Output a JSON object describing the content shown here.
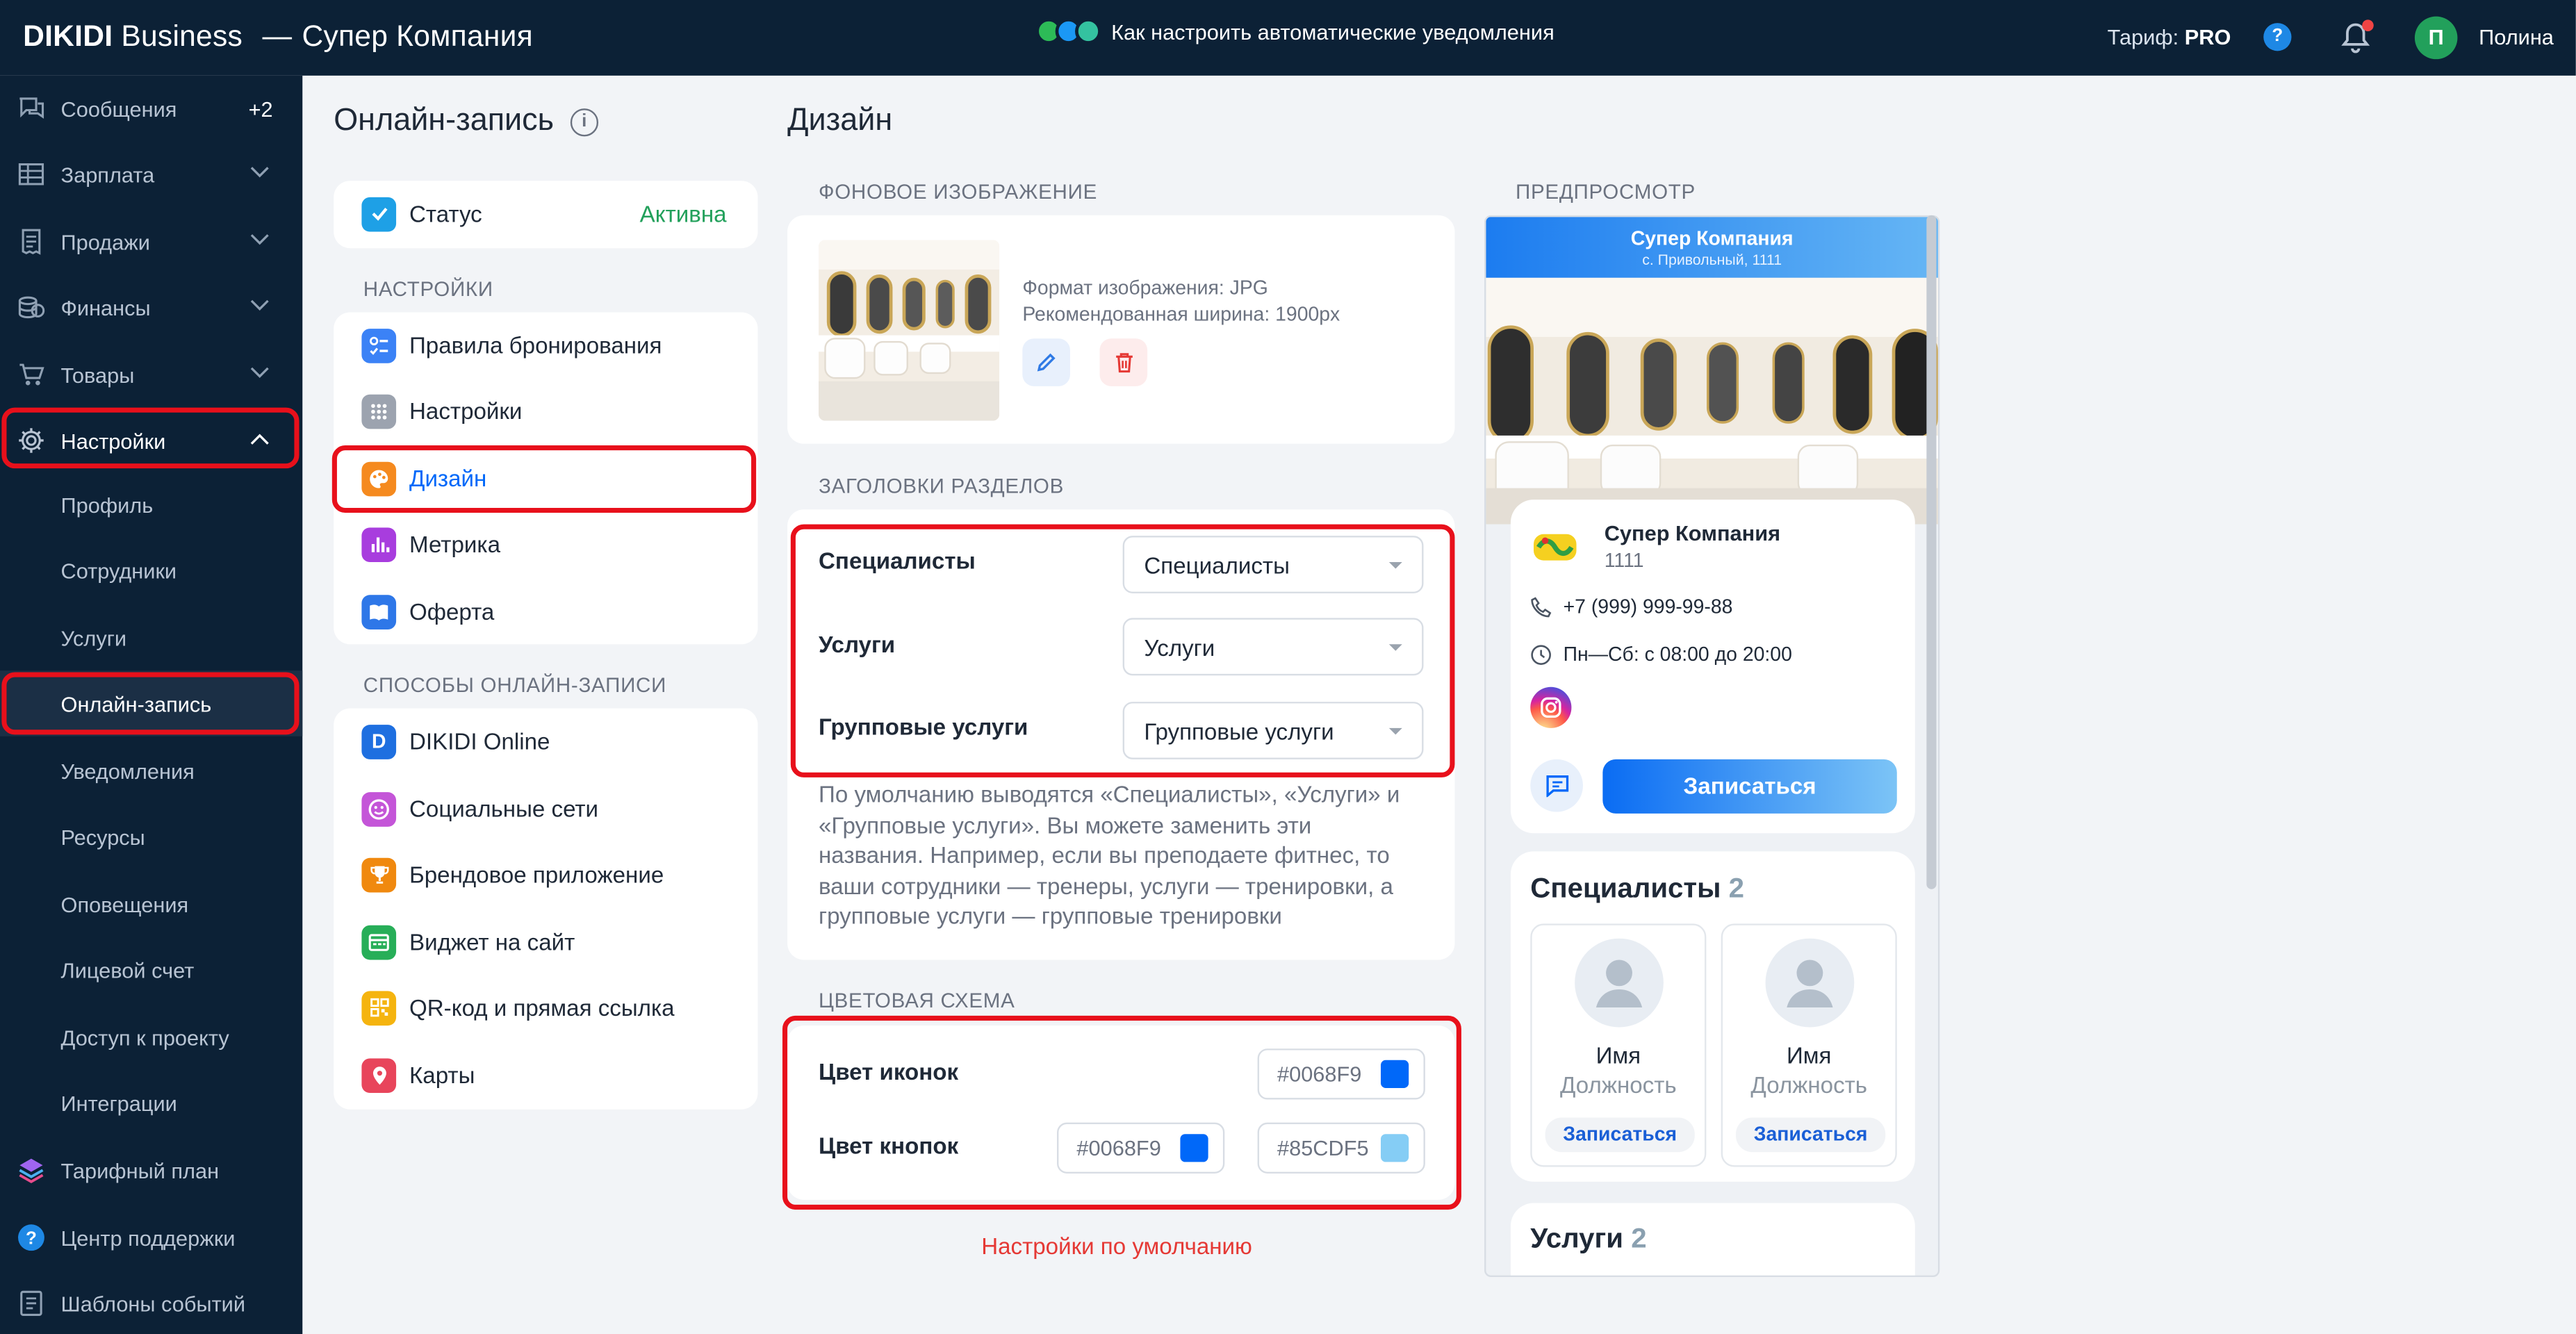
{
  "header": {
    "brand_bold": "DIKIDI",
    "brand_rest": " Business",
    "company": "Супер Компания",
    "promo": "Как настроить автоматические уведомления",
    "tarif_label": "Тариф:",
    "tarif_value": "PRO",
    "help": "?",
    "avatar_letter": "П",
    "user_name": "Полина"
  },
  "sidebar": {
    "items": [
      {
        "label": "Сообщения",
        "badge": "+2",
        "icon": "chat-icon"
      },
      {
        "label": "Зарплата",
        "icon": "salary-icon"
      },
      {
        "label": "Продажи",
        "icon": "receipt-icon"
      },
      {
        "label": "Финансы",
        "icon": "coins-icon"
      },
      {
        "label": "Товары",
        "icon": "cart-icon"
      },
      {
        "label": "Настройки",
        "icon": "gear-icon"
      }
    ],
    "settings_sub": [
      "Профиль",
      "Сотрудники",
      "Услуги",
      "Онлайн-запись",
      "Уведомления",
      "Ресурсы",
      "Оповещения",
      "Лицевой счет",
      "Доступ к проекту",
      "Интеграции"
    ],
    "bottom": [
      {
        "label": "Тарифный план",
        "icon": "layers-icon"
      },
      {
        "label": "Центр поддержки",
        "icon": "help-icon"
      },
      {
        "label": "Шаблоны событий",
        "icon": "template-icon"
      }
    ]
  },
  "online": {
    "title": "Онлайн-запись",
    "status_label": "Статус",
    "status_value": "Активна",
    "settings_head": "НАСТРОЙКИ",
    "settings": [
      "Правила бронирования",
      "Настройки",
      "Дизайн",
      "Метрика",
      "Оферта"
    ],
    "methods_head": "СПОСОБЫ ОНЛАЙН-ЗАПИСИ",
    "methods": [
      "DIKIDI Online",
      "Социальные сети",
      "Брендовое приложение",
      "Виджет на сайт",
      "QR-код и прямая ссылка",
      "Карты"
    ]
  },
  "design": {
    "title": "Дизайн",
    "bg_head": "ФОНОВОЕ ИЗОБРАЖЕНИЕ",
    "bg_format": "Формат изображения: JPG",
    "bg_width": "Рекомендованная ширина: 1900px",
    "headings_head": "ЗАГОЛОВКИ РАЗДЕЛОВ",
    "rows": [
      {
        "label": "Специалисты",
        "value": "Специалисты"
      },
      {
        "label": "Услуги",
        "value": "Услуги"
      },
      {
        "label": "Групповые услуги",
        "value": "Групповые услуги"
      }
    ],
    "help_text": "По умолчанию выводятся «Специалисты», «Услуги» и «Групповые услуги». Вы можете заменить эти названия. Например, если вы преподаете фитнес, то ваши сотрудники — тренеры, услуги — тренировки, а групповые услуги — групповые тренировки",
    "color_head": "ЦВЕТОВАЯ СХЕМА",
    "icon_color_label": "Цвет иконок",
    "icon_color": "#0068F9",
    "button_color_label": "Цвет кнопок",
    "button_color_1": "#0068F9",
    "button_color_2": "#85CDF5",
    "reset": "Настройки по умолчанию"
  },
  "preview": {
    "head": "ПРЕДПРОСМОТР",
    "company": "Супер Компания",
    "address": "с. Привольный, 1111",
    "card_name": "Супер Компания",
    "card_num": "1111",
    "phone": "+7 (999) 999-99-88",
    "hours": "Пн—Сб: с 08:00 до 20:00",
    "book": "Записаться",
    "spec_title": "Специалисты",
    "spec_count": "2",
    "specialists": [
      {
        "name": "Имя",
        "position": "Должность",
        "book": "Записаться"
      },
      {
        "name": "Имя",
        "position": "Должность",
        "book": "Записаться"
      }
    ],
    "services_title": "Услуги",
    "services_count": "2"
  }
}
